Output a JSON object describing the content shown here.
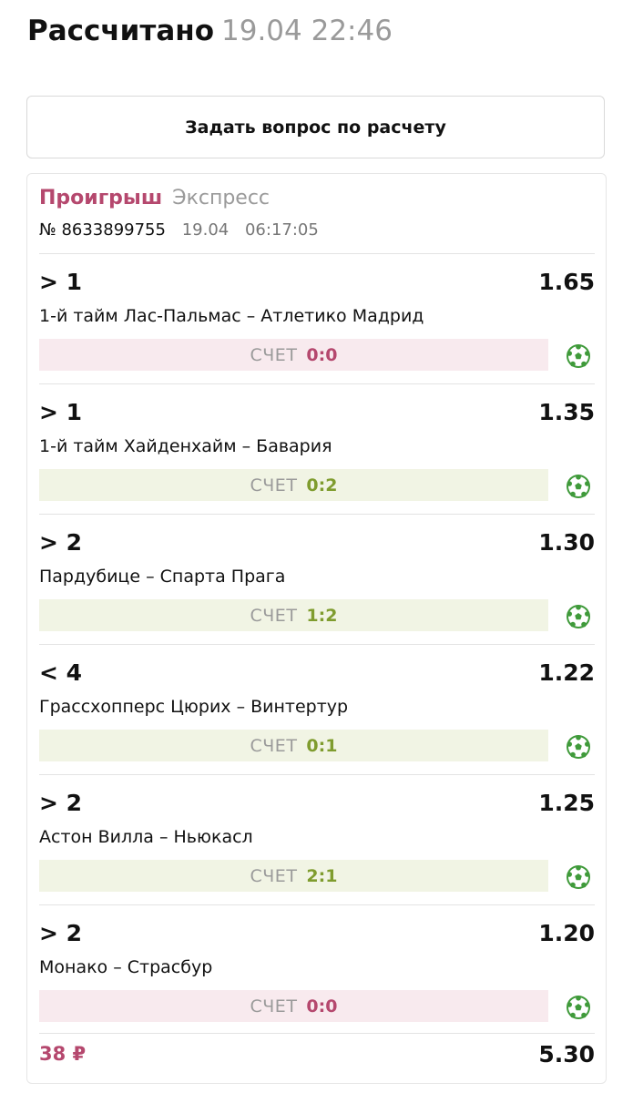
{
  "header": {
    "title": "Рассчитано",
    "timestamp": "19.04 22:46"
  },
  "ask_button_label": "Задать вопрос по расчету",
  "bet": {
    "status": "Проигрыш",
    "type": "Экспресс",
    "number": "№ 8633899755",
    "date": "19.04",
    "time": "06:17:05",
    "events": [
      {
        "outcome": "> 1",
        "coef": "1.65",
        "match": "1-й тайм Лас-Пальмас – Атлетико Мадрид",
        "score_label": "СЧЕТ",
        "score": "0:0",
        "result": "lost"
      },
      {
        "outcome": "> 1",
        "coef": "1.35",
        "match": "1-й тайм Хайденхайм – Бавария",
        "score_label": "СЧЕТ",
        "score": "0:2",
        "result": "won"
      },
      {
        "outcome": "> 2",
        "coef": "1.30",
        "match": "Пардубице – Спарта Прага",
        "score_label": "СЧЕТ",
        "score": "1:2",
        "result": "won"
      },
      {
        "outcome": "< 4",
        "coef": "1.22",
        "match": "Грассхопперс Цюрих – Винтертур",
        "score_label": "СЧЕТ",
        "score": "0:1",
        "result": "won"
      },
      {
        "outcome": "> 2",
        "coef": "1.25",
        "match": "Астон Вилла – Ньюкасл",
        "score_label": "СЧЕТ",
        "score": "2:1",
        "result": "won"
      },
      {
        "outcome": "> 2",
        "coef": "1.20",
        "match": "Монако – Страсбур",
        "score_label": "СЧЕТ",
        "score": "0:0",
        "result": "lost"
      }
    ],
    "stake": "38 ₽",
    "total_coef": "5.30"
  },
  "colors": {
    "lost_accent": "#b5486e",
    "won_accent": "#7f9c2e",
    "lost_bg": "#f8eaee",
    "won_bg": "#f1f4e4",
    "icon_green": "#3f9a3a"
  },
  "icons": {
    "sport": "soccer-ball-icon"
  }
}
